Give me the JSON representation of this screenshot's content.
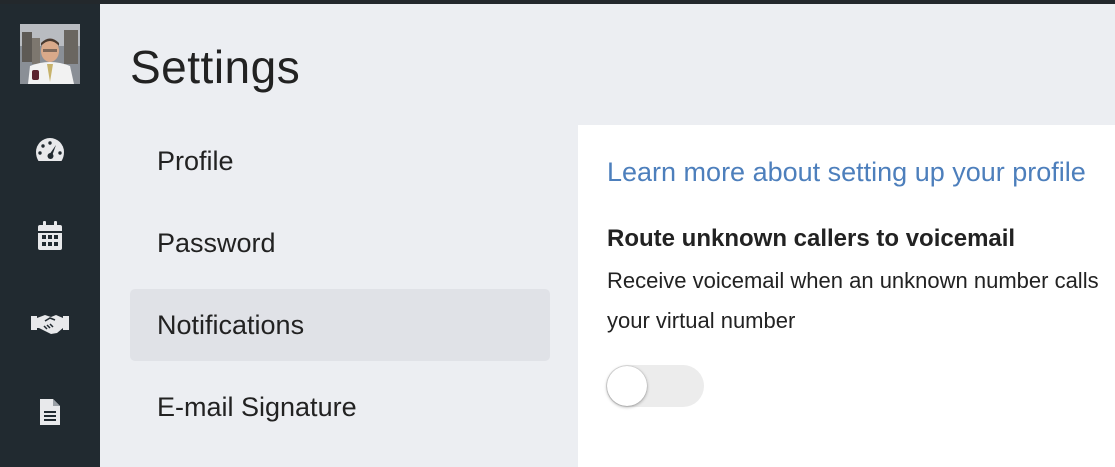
{
  "page": {
    "title": "Settings"
  },
  "sidebar": {
    "avatar": "user-avatar",
    "icons": [
      "dashboard-gauge-icon",
      "calendar-icon",
      "handshake-icon",
      "document-icon"
    ]
  },
  "settings_menu": {
    "items": [
      {
        "label": "Profile",
        "active": false
      },
      {
        "label": "Password",
        "active": false
      },
      {
        "label": "Notifications",
        "active": true
      },
      {
        "label": "E-mail Signature",
        "active": false
      }
    ]
  },
  "notifications_panel": {
    "learn_more_link": "Learn more about setting up your profile",
    "route_unknown": {
      "title": "Route unknown callers to voicemail",
      "description": "Receive voicemail when an unknown number calls your virtual number",
      "enabled": false
    }
  },
  "colors": {
    "sidebar_bg": "#212a30",
    "page_bg": "#eceef2",
    "active_item_bg": "#e0e2e7",
    "link": "#4d7fbc",
    "icon": "#e8e9eb"
  }
}
